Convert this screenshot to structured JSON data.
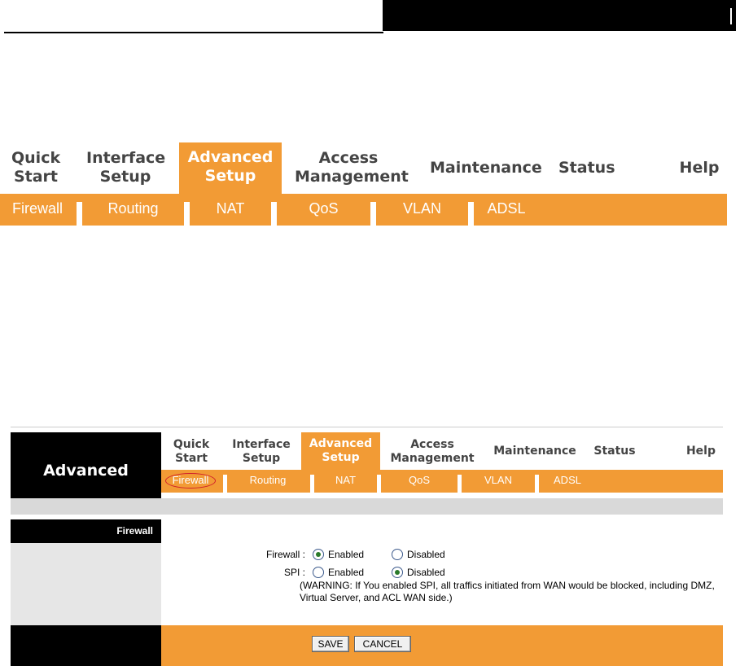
{
  "colors": {
    "accent": "#f29b35",
    "dark": "#000000"
  },
  "big_nav": {
    "tabs": [
      {
        "line1": "Quick",
        "line2": "Start"
      },
      {
        "line1": "Interface",
        "line2": "Setup"
      },
      {
        "line1": "Advanced",
        "line2": "Setup",
        "active": true
      },
      {
        "line1": "Access",
        "line2": "Management"
      },
      {
        "line1": "Maintenance",
        "line2": ""
      },
      {
        "line1": "Status",
        "line2": ""
      },
      {
        "line1": "Help",
        "line2": ""
      }
    ],
    "subtabs": [
      "Firewall",
      "Routing",
      "NAT",
      "QoS",
      "VLAN",
      "ADSL"
    ]
  },
  "shot": {
    "logo": "Advanced",
    "tabs": [
      {
        "line1": "Quick",
        "line2": "Start"
      },
      {
        "line1": "Interface",
        "line2": "Setup"
      },
      {
        "line1": "Advanced",
        "line2": "Setup",
        "active": true
      },
      {
        "line1": "Access",
        "line2": "Management"
      },
      {
        "line1": "Maintenance",
        "line2": ""
      },
      {
        "line1": "Status",
        "line2": ""
      },
      {
        "line1": "Help",
        "line2": ""
      }
    ],
    "subtabs": [
      "Firewall",
      "Routing",
      "NAT",
      "QoS",
      "VLAN",
      "ADSL"
    ],
    "section_title": "Firewall",
    "firewall_label": "Firewall :",
    "spi_label": "SPI :",
    "enabled": "Enabled",
    "disabled": "Disabled",
    "firewall_value": "Enabled",
    "spi_value": "Disabled",
    "warning": "(WARNING: If You enabled SPI, all traffics initiated from WAN would be blocked, including DMZ, Virtual Server, and ACL WAN side.)",
    "save_label": "SAVE",
    "cancel_label": "CANCEL"
  }
}
